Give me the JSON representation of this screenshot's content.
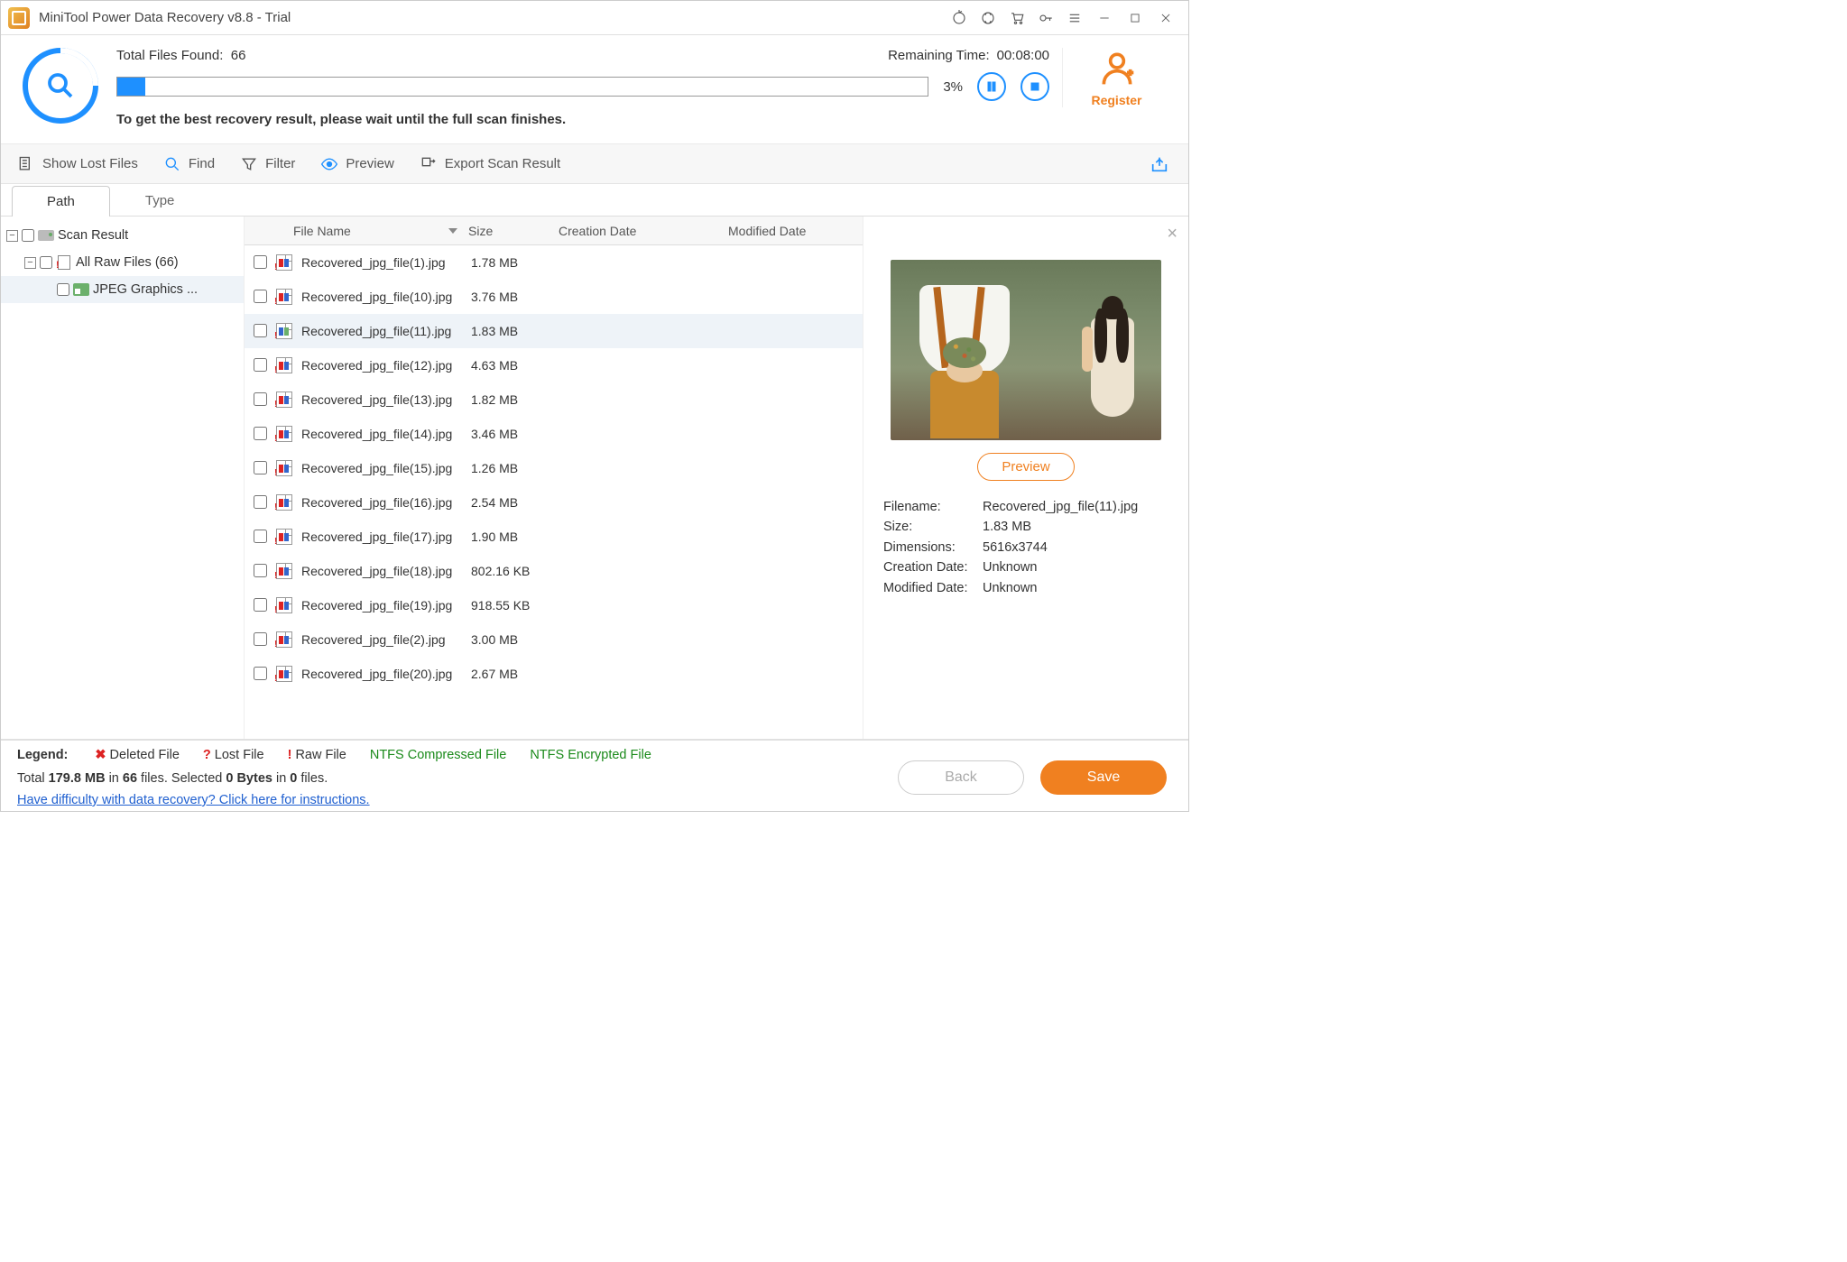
{
  "titlebar": {
    "title": "MiniTool Power Data Recovery v8.8 - Trial"
  },
  "scan": {
    "found_label": "Total Files Found:",
    "found_count": "66",
    "remaining_label": "Remaining Time:",
    "remaining_value": "00:08:00",
    "percent": "3%",
    "progress_pct": 3.5,
    "hint": "To get the best recovery result, please wait until the full scan finishes.",
    "register": "Register"
  },
  "toolbar": {
    "show_lost": "Show Lost Files",
    "find": "Find",
    "filter": "Filter",
    "preview": "Preview",
    "export": "Export Scan Result"
  },
  "tabs": {
    "path": "Path",
    "type": "Type"
  },
  "tree": {
    "scan_result": "Scan Result",
    "all_raw": "All Raw Files (66)",
    "jpeg": "JPEG Graphics ..."
  },
  "columns": {
    "name": "File Name",
    "size": "Size",
    "cdate": "Creation Date",
    "mdate": "Modified Date"
  },
  "files": [
    {
      "name": "Recovered_jpg_file(1).jpg",
      "size": "1.78 MB"
    },
    {
      "name": "Recovered_jpg_file(10).jpg",
      "size": "3.76 MB"
    },
    {
      "name": "Recovered_jpg_file(11).jpg",
      "size": "1.83 MB",
      "selected": true
    },
    {
      "name": "Recovered_jpg_file(12).jpg",
      "size": "4.63 MB"
    },
    {
      "name": "Recovered_jpg_file(13).jpg",
      "size": "1.82 MB"
    },
    {
      "name": "Recovered_jpg_file(14).jpg",
      "size": "3.46 MB"
    },
    {
      "name": "Recovered_jpg_file(15).jpg",
      "size": "1.26 MB"
    },
    {
      "name": "Recovered_jpg_file(16).jpg",
      "size": "2.54 MB"
    },
    {
      "name": "Recovered_jpg_file(17).jpg",
      "size": "1.90 MB"
    },
    {
      "name": "Recovered_jpg_file(18).jpg",
      "size": "802.16 KB"
    },
    {
      "name": "Recovered_jpg_file(19).jpg",
      "size": "918.55 KB"
    },
    {
      "name": "Recovered_jpg_file(2).jpg",
      "size": "3.00 MB"
    },
    {
      "name": "Recovered_jpg_file(20).jpg",
      "size": "2.67 MB"
    }
  ],
  "preview": {
    "btn": "Preview",
    "filename_lbl": "Filename:",
    "filename": "Recovered_jpg_file(11).jpg",
    "size_lbl": "Size:",
    "size": "1.83 MB",
    "dim_lbl": "Dimensions:",
    "dim": "5616x3744",
    "cdate_lbl": "Creation Date:",
    "cdate": "Unknown",
    "mdate_lbl": "Modified Date:",
    "mdate": "Unknown"
  },
  "legend": {
    "label": "Legend:",
    "deleted": "Deleted File",
    "lost": "Lost File",
    "raw": "Raw File",
    "compressed": "NTFS Compressed File",
    "encrypted": "NTFS Encrypted File",
    "summary_prefix": "Total ",
    "summary_size": "179.8 MB",
    "summary_mid1": " in ",
    "summary_count": "66",
    "summary_mid2": " files.  Selected ",
    "summary_sel_size": "0 Bytes",
    "summary_mid3": " in ",
    "summary_sel_count": "0",
    "summary_suffix": " files.",
    "help": "Have difficulty with data recovery? Click here for instructions."
  },
  "buttons": {
    "back": "Back",
    "save": "Save"
  }
}
